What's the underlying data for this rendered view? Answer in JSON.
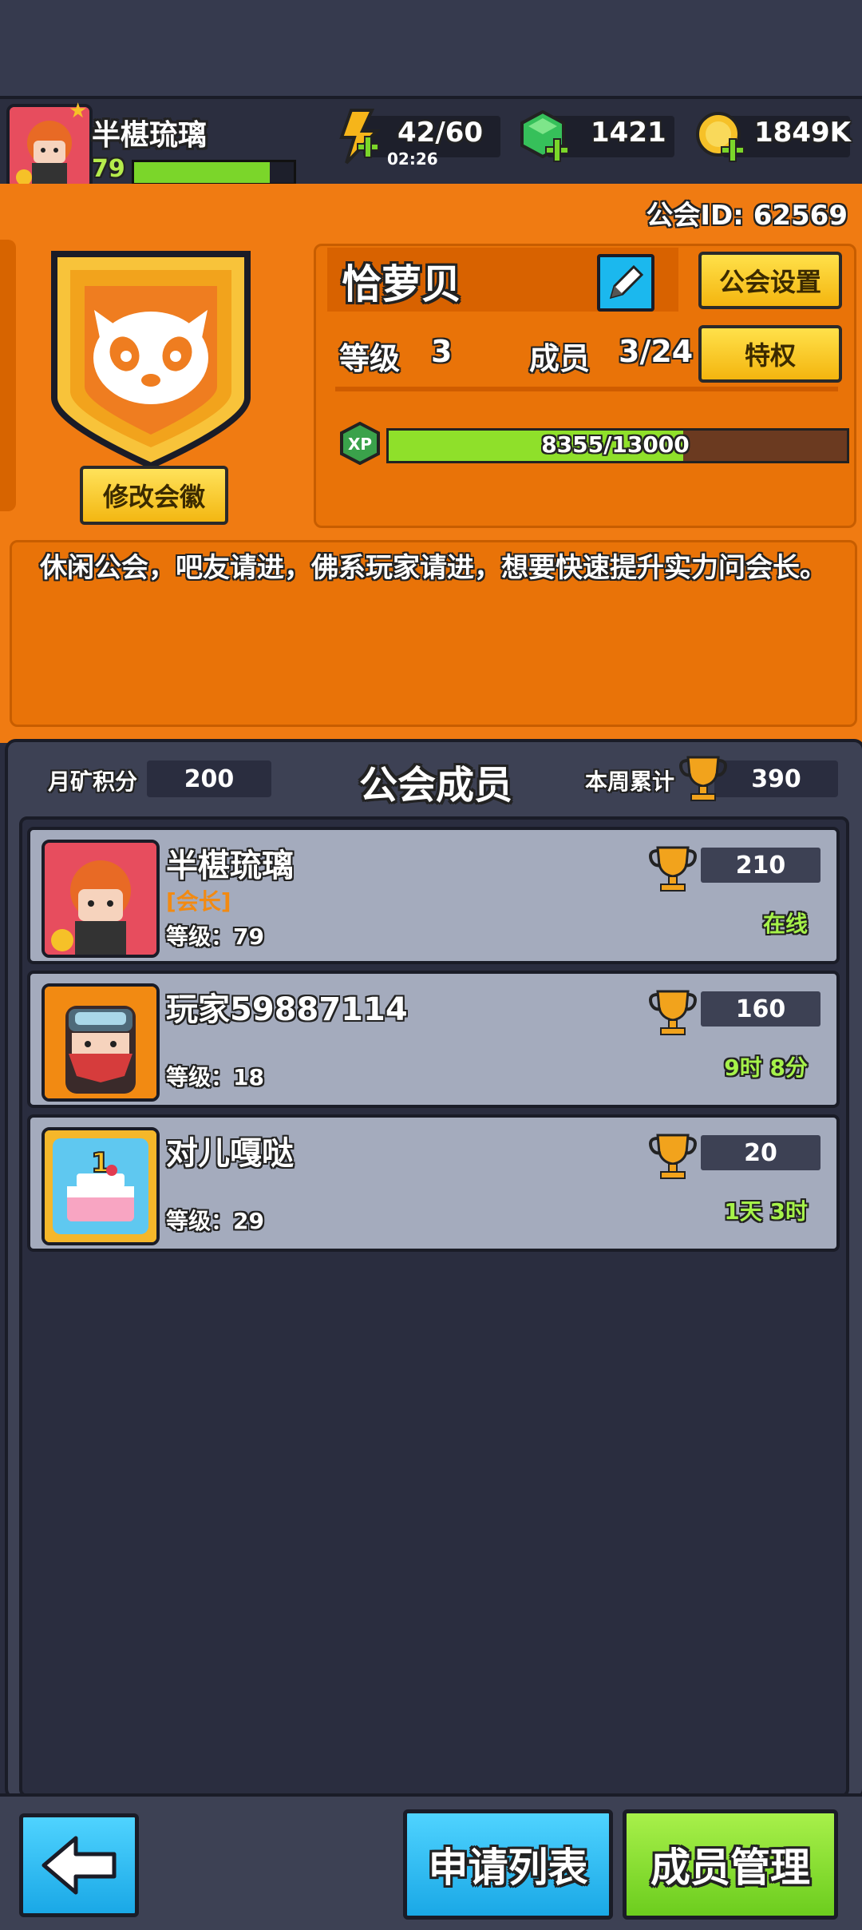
{
  "player": {
    "name": "半椹琉璃",
    "level": "79",
    "xp_fraction": 0.85
  },
  "resources": {
    "energy": "42/60",
    "energy_timer": "02:26",
    "gems": "1421",
    "coins": "1849K"
  },
  "guild": {
    "id_label": "公会ID: 62569",
    "name": "恰萝贝",
    "settings_label": "公会设置",
    "level_label": "等级",
    "level_value": "3",
    "members_label": "成员",
    "members_value": "3/24",
    "privilege_label": "特权",
    "xp_tag": "XP",
    "xp_text": "8355/13000",
    "xp_fraction": 0.643,
    "change_badge_label": "修改会徽",
    "description": "休闲公会，吧友请进，佛系玩家请进，想要快速提升实力问会长。"
  },
  "members_panel": {
    "monthly_label": "月矿积分",
    "monthly_value": "200",
    "title": "公会成员",
    "weekly_label": "本周累计",
    "weekly_value": "390"
  },
  "members": [
    {
      "name": "半椹琉璃",
      "role": "[会长]",
      "level": "等级：79",
      "score": "210",
      "status": "在线"
    },
    {
      "name": "玩家59887114",
      "level": "等级：18",
      "score": "160",
      "status": "9时 8分"
    },
    {
      "name": "对儿嘎哒",
      "level": "等级：29",
      "score": "20",
      "status": "1天 3时"
    }
  ],
  "bottom": {
    "apply_list": "申请列表",
    "member_manage": "成员管理"
  },
  "colors": {
    "orange": "#f07b12",
    "panel": "#3d4154",
    "green": "#a6f24a",
    "yellow": "#f4b50f",
    "blue": "#1bb8ee"
  }
}
